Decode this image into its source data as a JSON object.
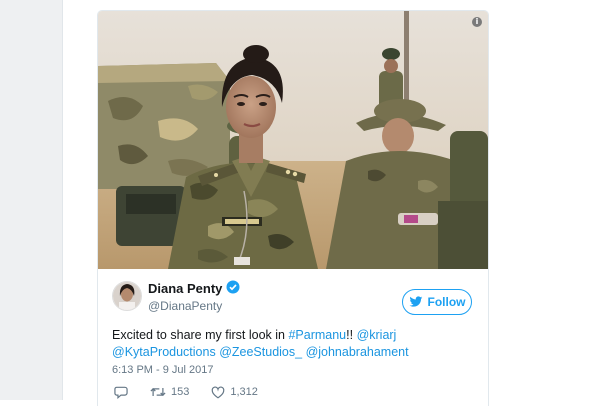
{
  "tweet": {
    "display_name": "Diana Penty",
    "username": "@DianaPenty",
    "follow_label": "Follow",
    "text": {
      "part1": "Excited to share my first look in ",
      "hashtag": "#Parmanu",
      "part2": "!! ",
      "mention1": "@kriarj",
      "mention2": "@KytaProductions",
      "mention3": "@ZeeStudios_",
      "mention4": "@johnabrahament"
    },
    "timestamp": "6:13 PM - 9 Jul 2017",
    "retweet_count": "153",
    "like_count": "1,312"
  },
  "icons": {
    "info": "info-icon",
    "verified": "verified-badge-icon",
    "follow": "bird-icon",
    "reply": "reply-icon",
    "retweet": "retweet-icon",
    "like": "heart-icon"
  },
  "colors": {
    "link": "#1b95e0",
    "verified": "#1da1f2",
    "secondary_text": "#657786",
    "primary_text": "#14171a"
  }
}
